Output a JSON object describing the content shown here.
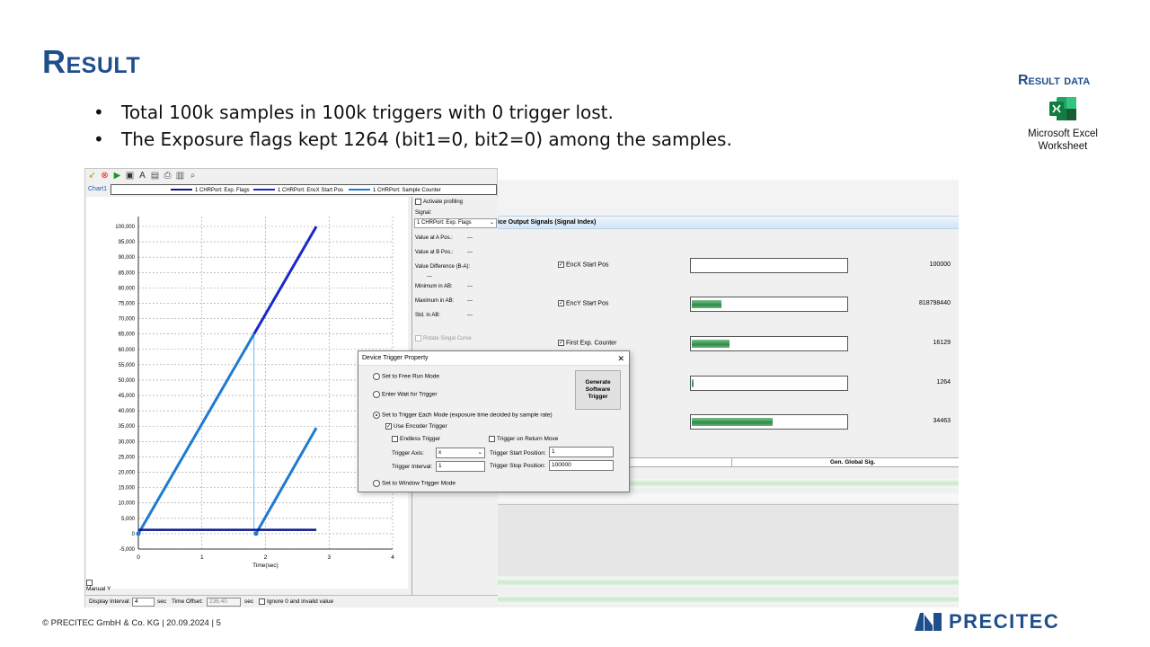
{
  "slide": {
    "title": "Result",
    "bullets": [
      "Total 100k samples in 100k triggers with 0 trigger lost.",
      "The Exposure flags kept 1264 (bit1=0, bit2=0) among the samples."
    ],
    "result_data_title": "Result data",
    "attachment_label": "Microsoft Excel Worksheet",
    "footer": "© PRECITEC GmbH & Co. KG | 20.09.2024 | 5",
    "logo_text": "PRECITEC",
    "colors": {
      "title": "#1f4e8c",
      "exp_flags": "#0d1a8a",
      "encx": "#1b27c9",
      "counter": "#1f7ad1"
    }
  },
  "plot_app": {
    "chart_tab": "Chart1",
    "legend": [
      "1 CHRPort: Exp. Flags",
      "1 CHRPort: EncX Start Pos",
      "1 CHRPort: Sample Counter"
    ],
    "side_panel": {
      "activate_profiling": "Activate profiling",
      "signal_label": "Signal:",
      "signal_value": "1 CHRPort: Exp. Flags",
      "value_a": "Value at A Pos.:",
      "value_b": "Value at B Pos.:",
      "value_diff": "Value Difference (B-A):",
      "minimum": "Minimum in AB:",
      "maximum": "Maximum in AB:",
      "std": "Std. in AB:",
      "dashes": "---",
      "rotate": "Rotate Singal Curve"
    },
    "manual_y": "Manual Y",
    "bottom": {
      "display_interval_label": "Display Interval:",
      "display_interval_value": "4",
      "sec1": "sec",
      "time_offset_label": "Time Offset:",
      "time_offset_value": "236.40",
      "sec2": "sec",
      "ignore_label": "Ignore 0 and invalid value"
    }
  },
  "chart_data": {
    "type": "line",
    "xlabel": "Time(sec)",
    "xlim": [
      0,
      4
    ],
    "ylim": [
      -5000,
      100000
    ],
    "x_ticks": [
      "0",
      "1",
      "2",
      "3",
      "4"
    ],
    "y_ticks": [
      "-5,000",
      "0",
      "5,000",
      "10,000",
      "15,000",
      "20,000",
      "25,000",
      "30,000",
      "35,000",
      "40,000",
      "45,000",
      "50,000",
      "55,000",
      "60,000",
      "65,000",
      "70,000",
      "75,000",
      "80,000",
      "85,000",
      "90,000",
      "95,000",
      "100,000"
    ],
    "y_tick_values": [
      -5000,
      0,
      5000,
      10000,
      15000,
      20000,
      25000,
      30000,
      35000,
      40000,
      45000,
      50000,
      55000,
      60000,
      65000,
      70000,
      75000,
      80000,
      85000,
      90000,
      95000,
      100000
    ],
    "grid": true,
    "series": [
      {
        "name": "1 CHRPort: Exp. Flags",
        "x": [
          0,
          2.8
        ],
        "y": [
          1264,
          1264
        ]
      },
      {
        "name": "1 CHRPort: EncX Start Pos",
        "x": [
          0,
          1.82,
          1.82,
          2.8
        ],
        "y": [
          0,
          65000,
          65000,
          100000
        ]
      },
      {
        "name": "1 CHRPort: Sample Counter",
        "x": [
          0,
          1.82,
          1.82,
          1.85,
          2.8
        ],
        "y": [
          0,
          65000,
          0,
          0,
          34463
        ]
      }
    ]
  },
  "signals_app": {
    "header": "ice Output Signals (Signal Index)",
    "signals": [
      {
        "label": "EncX Start Pos",
        "value": "100000",
        "fill": 0.0
      },
      {
        "label": "EncY Start Pos",
        "value": "818798440",
        "fill": 0.19
      },
      {
        "label": "First Exp. Counter",
        "value": "16129",
        "fill": 0.24
      },
      {
        "label": "",
        "value": "1264",
        "fill": 0.01
      },
      {
        "label": "",
        "value": "34463",
        "fill": 0.52
      }
    ],
    "table_header": "Gen. Global Sig."
  },
  "dialog": {
    "title": "Device Trigger Property",
    "close": "✕",
    "free_run": "Set to Free Run Mode",
    "enter_wait": "Enter Wait for Trigger",
    "trigger_each": "Set to Trigger Each Mode (exposure time decided by sample rate)",
    "use_encoder": "Use Encoder Trigger",
    "endless": "Endless Trigger",
    "trigger_return": "Trigger on Return Move",
    "axis_label": "Trigger Axis:",
    "axis_value": "x",
    "start_label": "Trigger Start Position:",
    "start_value": "1",
    "interval_label": "Trigger Interval:",
    "interval_value": "1",
    "stop_label": "Trigger Stop Position:",
    "stop_value": "100000",
    "window_mode": "Set to Window Trigger Mode",
    "generate_button": "Generate Software Trigger"
  }
}
